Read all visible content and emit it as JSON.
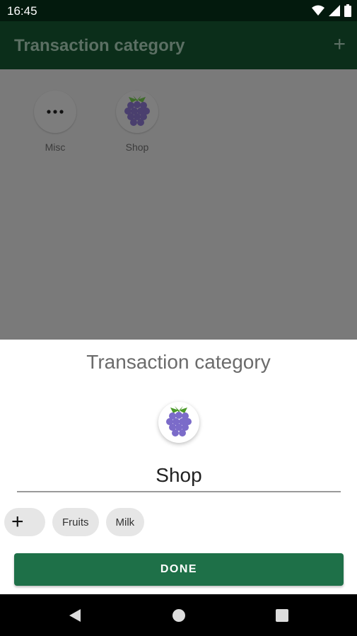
{
  "status_bar": {
    "time": "16:45"
  },
  "app_bar": {
    "title": "Transaction category",
    "add_icon": "+"
  },
  "categories": [
    {
      "label": "Misc",
      "icon": "more-dots-icon"
    },
    {
      "label": "Shop",
      "icon": "grapes-icon"
    }
  ],
  "dialog": {
    "title": "Transaction category",
    "icon": "grapes-icon",
    "name_value": "Shop",
    "chips": [
      {
        "label": "+"
      },
      {
        "label": "Fruits"
      },
      {
        "label": "Milk"
      }
    ],
    "done_label": "DONE"
  },
  "colors": {
    "primary": "#1e7048",
    "status_bar": "#031a0d",
    "app_bar": "#0b2e1a",
    "scrim": "#7a7a7a"
  }
}
